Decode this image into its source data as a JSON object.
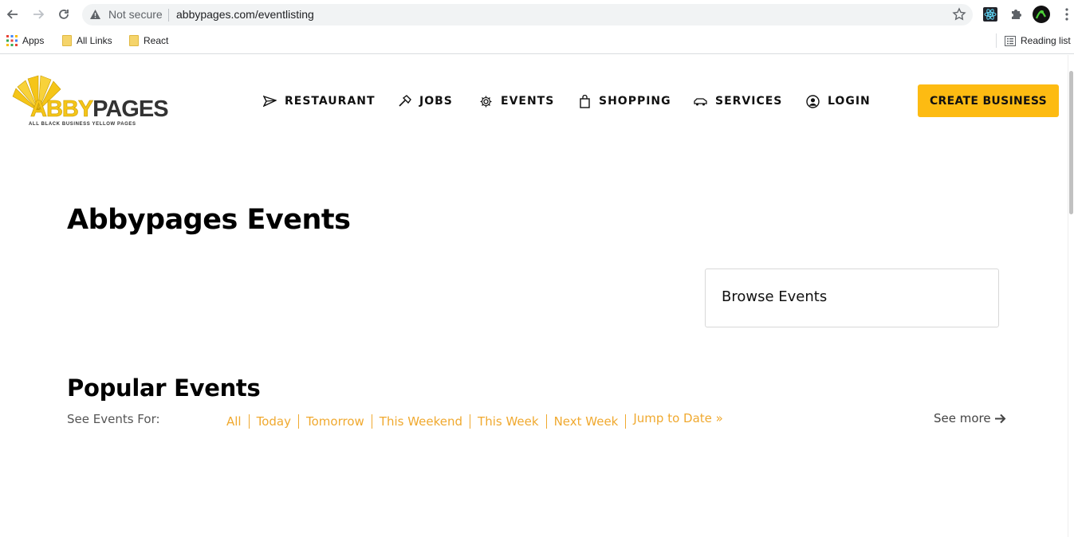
{
  "browser": {
    "security_label": "Not secure",
    "url": "abbypages.com/eventlisting",
    "bookmarks": [
      {
        "label": "Apps",
        "icon": "apps-grid-icon"
      },
      {
        "label": "All Links",
        "icon": "folder-icon"
      },
      {
        "label": "React",
        "icon": "folder-icon"
      }
    ],
    "reading_list": "Reading list"
  },
  "logo": {
    "brand_first": "ABBY",
    "brand_second": "PAGES",
    "tagline": "ALL BLACK BUSINESS YELLOW PAGES"
  },
  "nav": {
    "items": [
      {
        "label": "RESTAURANT",
        "icon": "paper-plane-icon"
      },
      {
        "label": "JOBS",
        "icon": "hammer-icon"
      },
      {
        "label": "EVENTS",
        "icon": "gear-icon"
      },
      {
        "label": "SHOPPING",
        "icon": "shopping-bag-icon"
      },
      {
        "label": "SERVICES",
        "icon": "car-icon"
      },
      {
        "label": "LOGIN",
        "icon": "user-circle-icon"
      }
    ],
    "cta": "CREATE BUSINESS"
  },
  "main": {
    "title": "Abbypages Events",
    "browse": "Browse Events",
    "popular_title": "Popular Events",
    "see_events_for": "See Events For:",
    "filters": [
      "All",
      "Today",
      "Tomorrow",
      "This Weekend",
      "This Week",
      "Next Week"
    ],
    "jump_to_date": "Jump to Date »",
    "see_more": "See more"
  },
  "colors": {
    "accent": "#fdbb12",
    "filter_link": "#f0a92f",
    "logo_yellow": "#f5c518"
  }
}
